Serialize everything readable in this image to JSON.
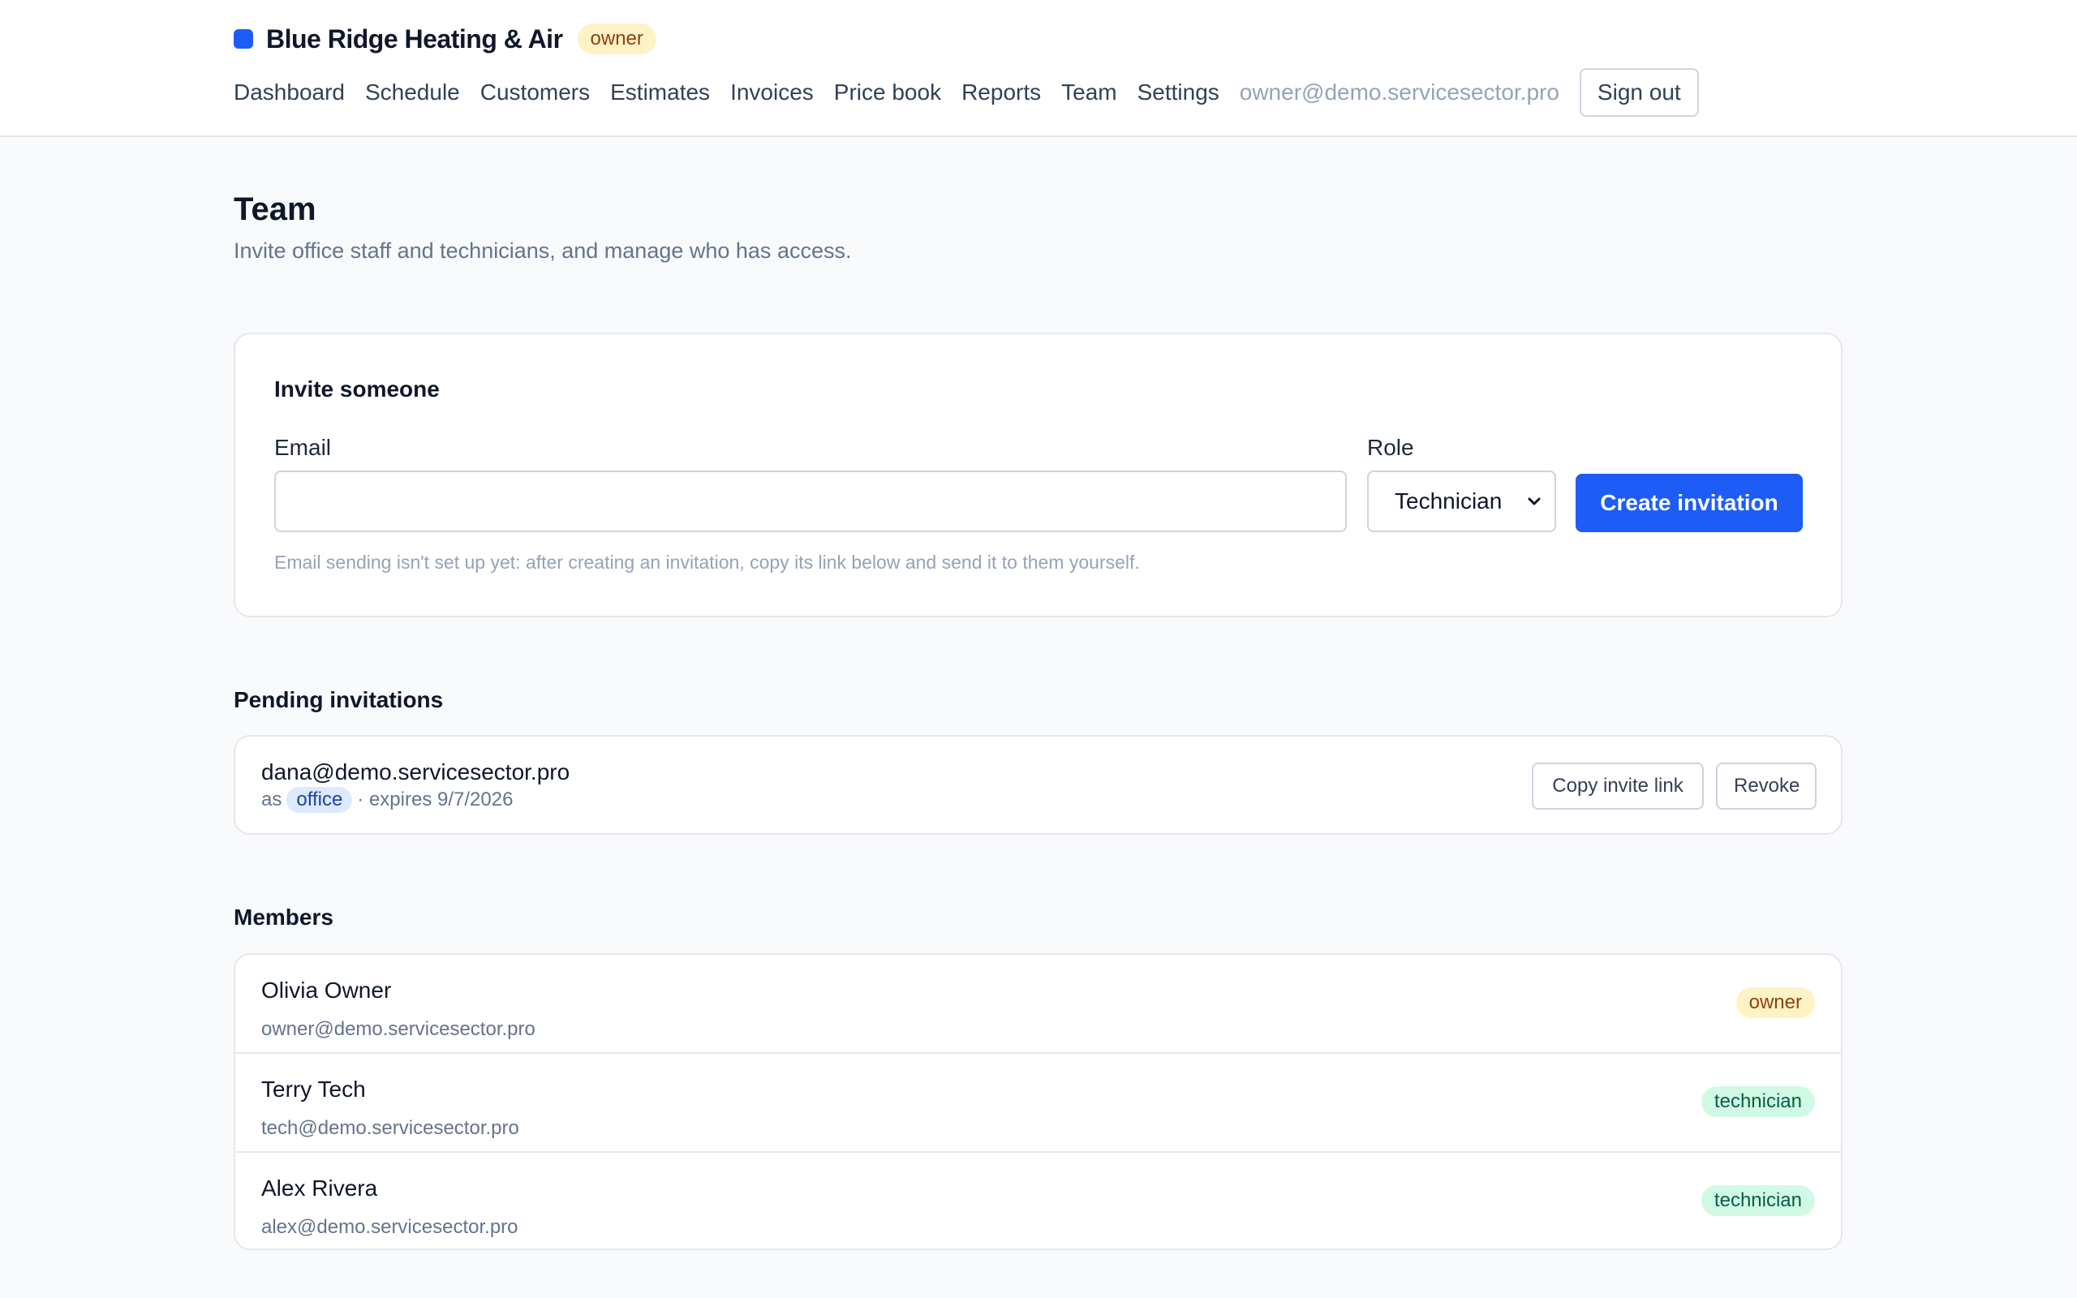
{
  "header": {
    "brand_name": "Blue Ridge Heating & Air",
    "role_badge": "owner",
    "nav": [
      "Dashboard",
      "Schedule",
      "Customers",
      "Estimates",
      "Invoices",
      "Price book",
      "Reports",
      "Team",
      "Settings"
    ],
    "user_email": "owner@demo.servicesector.pro",
    "sign_out_label": "Sign out"
  },
  "page": {
    "title": "Team",
    "subtitle": "Invite office staff and technicians, and manage who has access."
  },
  "invite": {
    "title": "Invite someone",
    "email_label": "Email",
    "email_value": "",
    "role_label": "Role",
    "role_selected": "Technician",
    "submit_label": "Create invitation",
    "hint": "Email sending isn't set up yet: after creating an invitation, copy its link below and send it to them yourself."
  },
  "pending": {
    "title": "Pending invitations",
    "items": [
      {
        "email": "dana@demo.servicesector.pro",
        "as_label": "as",
        "role": "office",
        "expires": "· expires 9/7/2026",
        "copy_label": "Copy invite link",
        "revoke_label": "Revoke"
      }
    ]
  },
  "members": {
    "title": "Members",
    "items": [
      {
        "name": "Olivia Owner",
        "email": "owner@demo.servicesector.pro",
        "role": "owner"
      },
      {
        "name": "Terry Tech",
        "email": "tech@demo.servicesector.pro",
        "role": "technician"
      },
      {
        "name": "Alex Rivera",
        "email": "alex@demo.servicesector.pro",
        "role": "technician"
      }
    ]
  },
  "colors": {
    "accent": "#1d5cf5",
    "owner_badge_bg": "#fef3c7",
    "technician_badge_bg": "#d1fae5",
    "office_badge_bg": "#dbeafe"
  },
  "icons": {
    "brand": "brand-square-icon",
    "select": "chevron-down-icon"
  }
}
